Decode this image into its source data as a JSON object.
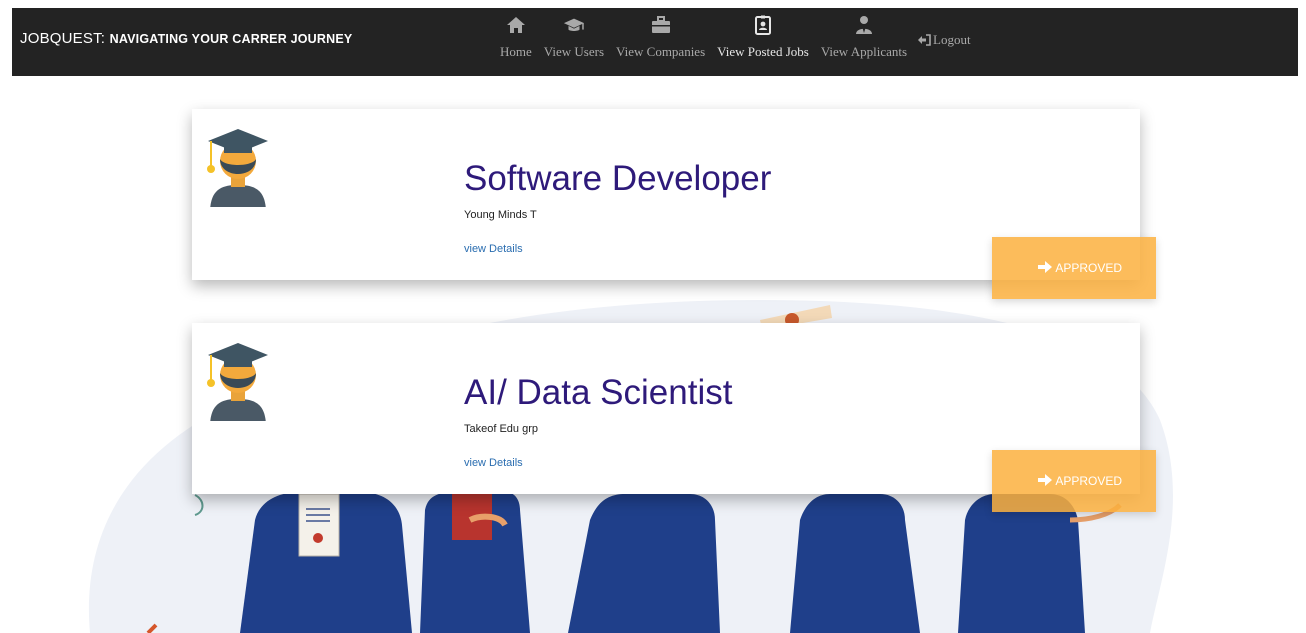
{
  "brand": {
    "prefix": "JOBQUEST:",
    "tagline": "NAVIGATING YOUR CARRER JOURNEY"
  },
  "nav": [
    {
      "label": "Home",
      "icon": "home-icon"
    },
    {
      "label": "View Users",
      "icon": "graduation-cap-icon"
    },
    {
      "label": "View Companies",
      "icon": "briefcase-icon"
    },
    {
      "label": "View Posted Jobs",
      "icon": "id-badge-icon",
      "active": true
    },
    {
      "label": "View Applicants",
      "icon": "user-tie-icon"
    }
  ],
  "logout": {
    "label": "Logout",
    "icon": "sign-in-icon"
  },
  "jobs": [
    {
      "title": "Software Developer",
      "company": "Young Minds T",
      "details_label": "view Details",
      "status": "APPROVED"
    },
    {
      "title": "AI/ Data Scientist",
      "company": "Takeof Edu grp",
      "details_label": "view Details",
      "status": "APPROVED"
    }
  ],
  "colors": {
    "navbar": "#232323",
    "title": "#2e1a7a",
    "link": "#2a6db0",
    "approved": "#fcb03e",
    "gown": "#2a4a8c"
  }
}
